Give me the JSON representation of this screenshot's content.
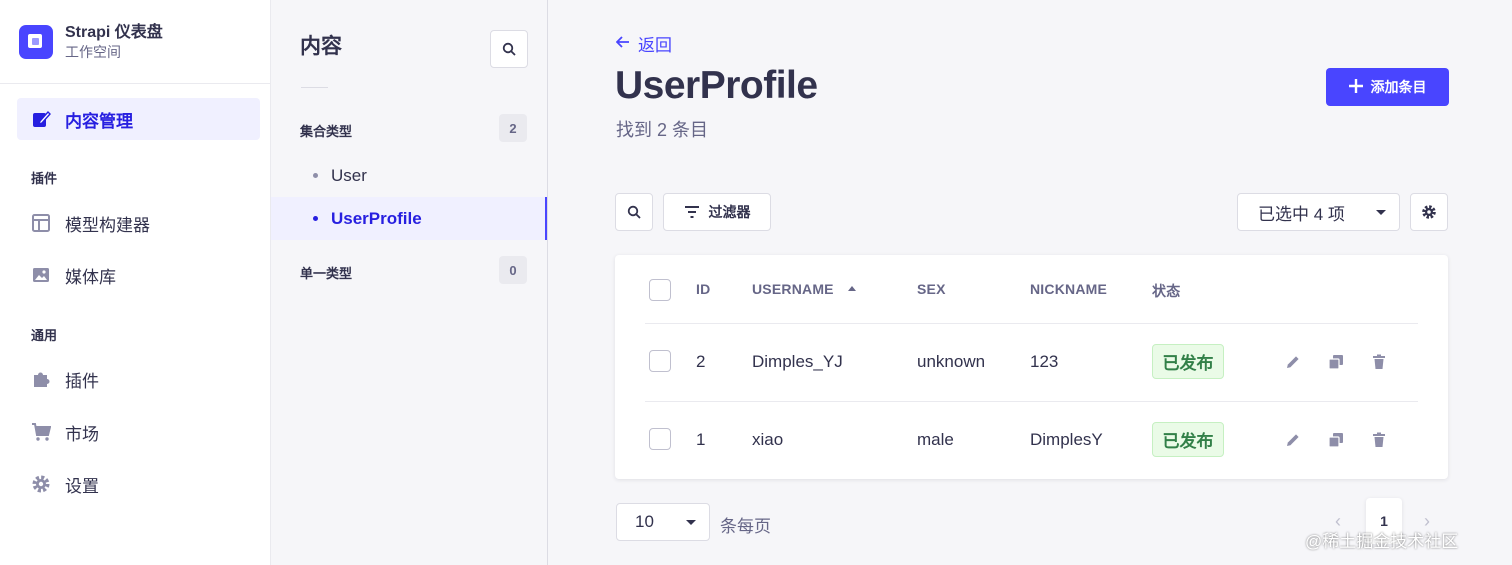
{
  "brand": {
    "title": "Strapi 仪表盘",
    "subtitle": "工作空间"
  },
  "mainnav": {
    "content_manager": "内容管理",
    "plugins_section": "插件",
    "content_type_builder": "模型构建器",
    "media_library": "媒体库",
    "general_section": "通用",
    "plugins": "插件",
    "marketplace": "市场",
    "settings": "设置"
  },
  "subnav": {
    "title": "内容",
    "collection_types": {
      "label": "集合类型",
      "count": "2",
      "items": [
        "User",
        "UserProfile"
      ]
    },
    "single_types": {
      "label": "单一类型",
      "count": "0"
    }
  },
  "header": {
    "back": "返回",
    "title": "UserProfile",
    "subtitle": "找到 2 条目",
    "add_button": "添加条目"
  },
  "toolbar": {
    "filter": "过滤器",
    "columns_selected": "已选中 4 项"
  },
  "table": {
    "headers": [
      "ID",
      "USERNAME",
      "SEX",
      "NICKNAME",
      "状态"
    ],
    "rows": [
      {
        "id": "2",
        "username": "Dimples_YJ",
        "sex": "unknown",
        "nickname": "123",
        "status": "已发布"
      },
      {
        "id": "1",
        "username": "xiao",
        "sex": "male",
        "nickname": "DimplesY",
        "status": "已发布"
      }
    ]
  },
  "pagination": {
    "page_size": "10",
    "page_size_label": "条每页",
    "current_page": "1",
    "prev": "‹",
    "next": "›"
  },
  "watermark": "@稀土掘金技术社区",
  "colors": {
    "primary": "#4945ff",
    "published_bg": "#eafbe7",
    "published_text": "#328048"
  }
}
